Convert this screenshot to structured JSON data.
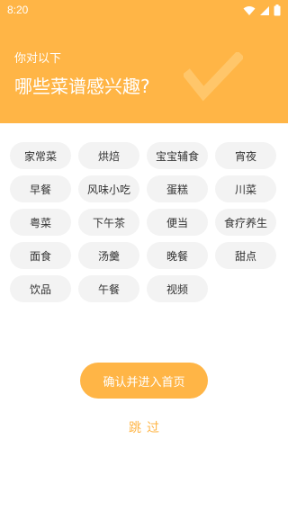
{
  "status_bar": {
    "time": "8:20"
  },
  "header": {
    "subtitle": "你对以下",
    "title": "哪些菜谱感兴趣?",
    "bg_color": "#ffb546"
  },
  "tags": [
    {
      "label": "家常菜"
    },
    {
      "label": "烘焙"
    },
    {
      "label": "宝宝辅食"
    },
    {
      "label": "宵夜"
    },
    {
      "label": "早餐"
    },
    {
      "label": "风味小吃"
    },
    {
      "label": "蛋糕"
    },
    {
      "label": "川菜"
    },
    {
      "label": "粤菜"
    },
    {
      "label": "下午茶"
    },
    {
      "label": "便当"
    },
    {
      "label": "食疗养生"
    },
    {
      "label": "面食"
    },
    {
      "label": "汤羹"
    },
    {
      "label": "晚餐"
    },
    {
      "label": "甜点"
    },
    {
      "label": "饮品"
    },
    {
      "label": "午餐"
    },
    {
      "label": "视频"
    }
  ],
  "actions": {
    "confirm_label": "确认并进入首页",
    "skip_label": "跳过"
  },
  "icons": {
    "wifi": "wifi-icon",
    "signal": "signal-icon",
    "battery": "battery-icon",
    "check": "check-icon"
  }
}
